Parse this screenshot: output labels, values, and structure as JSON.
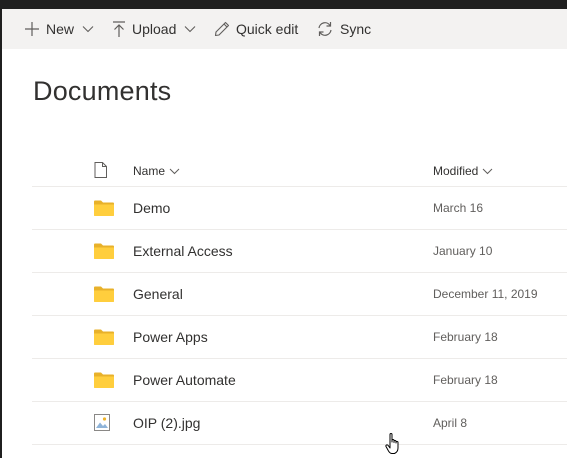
{
  "toolbar": {
    "new_label": "New",
    "upload_label": "Upload",
    "quick_edit_label": "Quick edit",
    "sync_label": "Sync"
  },
  "library": {
    "title": "Documents",
    "columns": {
      "name": "Name",
      "modified": "Modified"
    },
    "rows": [
      {
        "name": "Demo",
        "modified": "March 16",
        "type": "folder"
      },
      {
        "name": "External Access",
        "modified": "January 10",
        "type": "folder"
      },
      {
        "name": "General",
        "modified": "December 11, 2019",
        "type": "folder"
      },
      {
        "name": "Power Apps",
        "modified": "February 18",
        "type": "folder"
      },
      {
        "name": "Power Automate",
        "modified": "February 18",
        "type": "folder"
      },
      {
        "name": "OIP (2).jpg",
        "modified": "April 8",
        "type": "image"
      }
    ]
  },
  "colors": {
    "folder": "#ffce3d",
    "folder_tab": "#e8b12a",
    "command_bar": "#f3f2f1",
    "text": "#323130",
    "secondary_text": "#605e5c"
  }
}
